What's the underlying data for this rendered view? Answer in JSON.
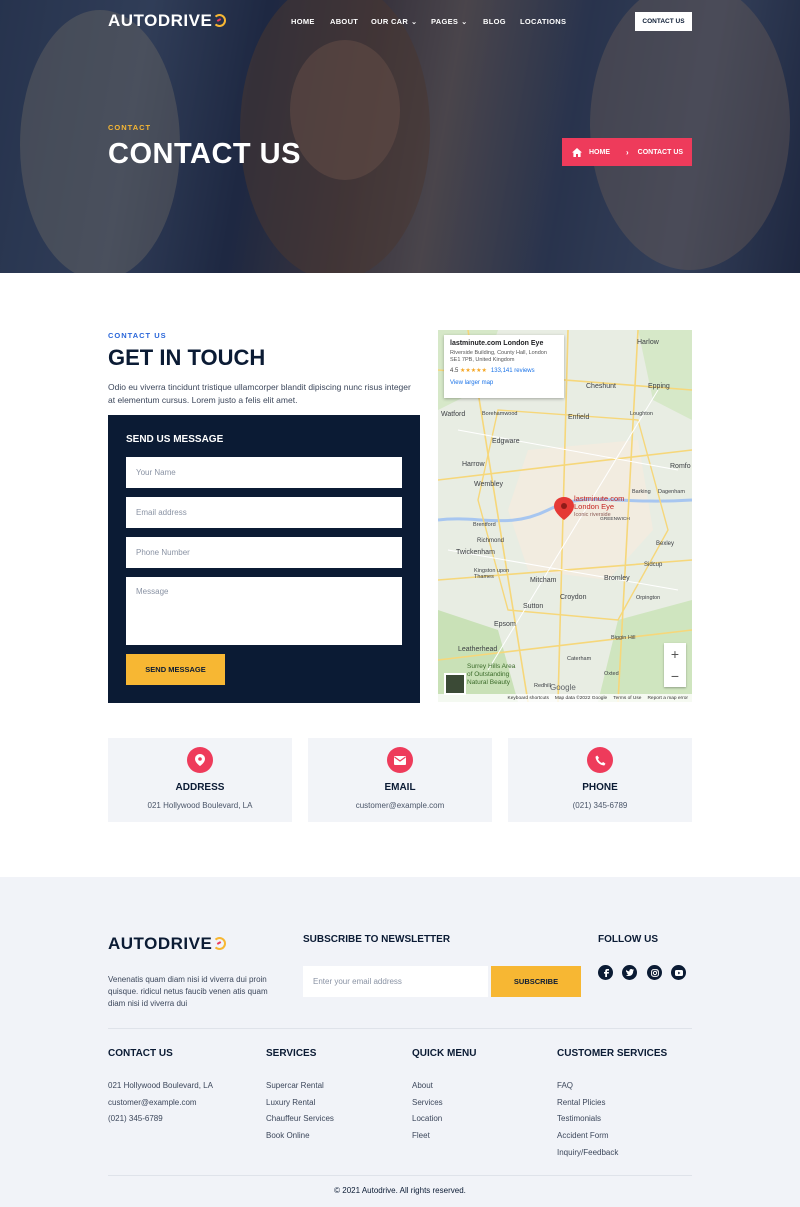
{
  "brand": {
    "name": "AUTODRIVE",
    "accent": "#f7b733",
    "primary": "#ee3b5b",
    "navy": "#0b1b34"
  },
  "nav": {
    "items": [
      {
        "label": "HOME",
        "dropdown": false
      },
      {
        "label": "ABOUT",
        "dropdown": false
      },
      {
        "label": "OUR CAR",
        "dropdown": true
      },
      {
        "label": "PAGES",
        "dropdown": true
      },
      {
        "label": "BLOG",
        "dropdown": false
      },
      {
        "label": "LOCATIONS",
        "dropdown": false
      }
    ],
    "cta": "CONTACT US"
  },
  "hero": {
    "subtitle": "CONTACT",
    "title": "CONTACT US",
    "breadcrumb": {
      "home": "HOME",
      "current": "CONTACT US",
      "home_icon": "home-icon"
    }
  },
  "contact": {
    "eyebrow": "CONTACT US",
    "title": "GET IN TOUCH",
    "intro": "Odio eu viverra tincidunt tristique ullamcorper blandit dipiscing nunc risus integer at elementum cursus. Lorem justo a felis elit amet.",
    "form": {
      "title": "SEND US MESSAGE",
      "name_placeholder": "Your Name",
      "email_placeholder": "Email address",
      "phone_placeholder": "Phone Number",
      "message_placeholder": "Message",
      "submit": "SEND MESSAGE"
    }
  },
  "map": {
    "card": {
      "title": "lastminute.com London Eye",
      "address": "Riverside Building, County Hall, London SE1 7PB, United Kingdom",
      "rating": "4.5",
      "stars": "★★★★★",
      "reviews": "133,141 reviews",
      "link": "View larger map"
    },
    "pin": {
      "line1": "lastminute.com",
      "line2": "London Eye",
      "line3": "Iconic riverside"
    },
    "labels": {
      "harlow": "Harlow",
      "cheshunt": "Cheshunt",
      "epping": "Epping",
      "watford": "Watford",
      "borehamwood": "Borehamwood",
      "enfield": "Enfield",
      "loughton": "Loughton",
      "edgware": "Edgware",
      "harrow": "Harrow",
      "romford": "Romfo",
      "wembley": "Wembley",
      "barking": "Barking",
      "dagenham": "Dagenham",
      "brentford": "Brentford",
      "greenwich": "GREENWICH",
      "richmond": "Richmond",
      "twickenham": "Twickenham",
      "kingston": "Kingston upon Thames",
      "bexley": "Bexley",
      "sidcup": "Sidcup",
      "mitcham": "Mitcham",
      "bromley": "Bromley",
      "croydon": "Croydon",
      "sutton": "Sutton",
      "orpington": "Orpington",
      "epsom": "Epsom",
      "biggin": "Biggin Hill",
      "leatherhead": "Leatherhead",
      "caterham": "Caterham",
      "surrey": "Surrey Hills Area of Outstanding Natural Beauty",
      "redhill": "Redhill",
      "oxted": "Oxted"
    },
    "zoom_in": "+",
    "zoom_out": "−",
    "google": "Google",
    "footer": {
      "shortcuts": "Keyboard shortcuts",
      "data": "Map data ©2022 Google",
      "terms": "Terms of Use",
      "report": "Report a map error"
    }
  },
  "info_cards": [
    {
      "icon": "map-pin-icon",
      "title": "ADDRESS",
      "text": "021 Hollywood Boulevard, LA"
    },
    {
      "icon": "envelope-icon",
      "title": "EMAIL",
      "text": "customer@example.com"
    },
    {
      "icon": "phone-icon",
      "title": "PHONE",
      "text": "(021) 345-6789"
    }
  ],
  "footer": {
    "description": "Venenatis quam diam nisi id viverra dui proin quisque. ridicul netus faucib venen atis quam diam nisi id viverra dui",
    "newsletter": {
      "title": "SUBSCRIBE TO NEWSLETTER",
      "placeholder": "Enter your email address",
      "button": "SUBSCRIBE"
    },
    "follow": {
      "title": "FOLLOW US",
      "icons": [
        "facebook-icon",
        "twitter-icon",
        "instagram-icon",
        "youtube-icon"
      ]
    },
    "columns": {
      "contact": {
        "title": "CONTACT US",
        "items": [
          "021 Hollywood Boulevard, LA",
          "customer@example.com",
          "(021) 345-6789"
        ]
      },
      "services": {
        "title": "SERVICES",
        "items": [
          "Supercar Rental",
          "Luxury Rental",
          "Chauffeur Services",
          "Book Online"
        ]
      },
      "quick": {
        "title": "QUICK MENU",
        "items": [
          "About",
          "Services",
          "Location",
          "Fleet"
        ]
      },
      "customer": {
        "title": "CUSTOMER SERVICES",
        "items": [
          "FAQ",
          "Rental Plicies",
          "Testimonials",
          "Accident Form",
          "Inquiry/Feedback"
        ]
      }
    },
    "copyright": "© 2021 Autodrive. All rights reserved."
  }
}
